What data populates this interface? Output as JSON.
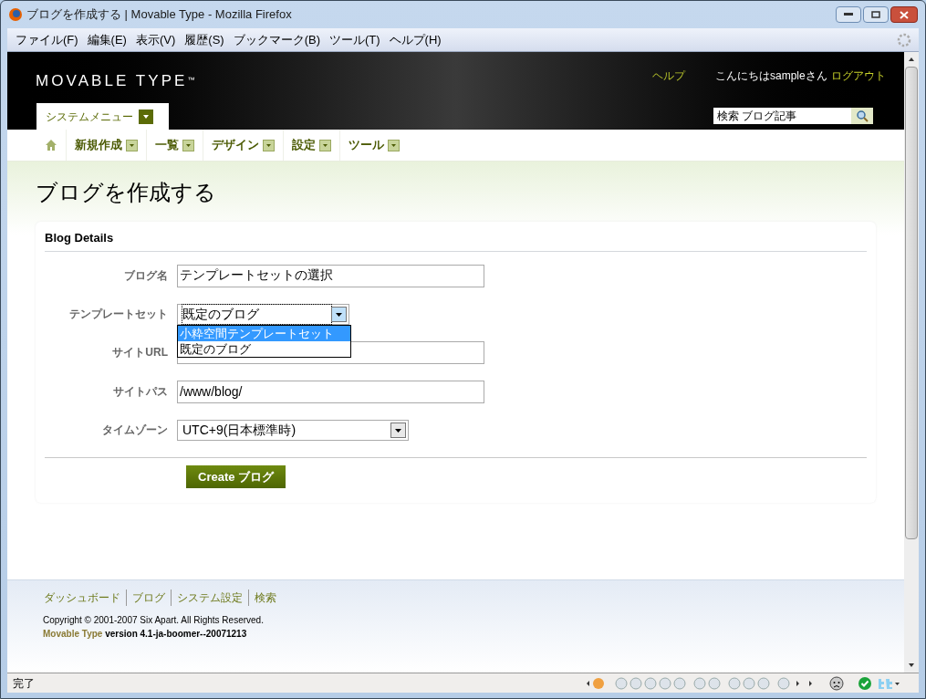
{
  "window": {
    "title": "ブログを作成する | Movable Type - Mozilla Firefox"
  },
  "menu_bar": [
    "ファイル(F)",
    "編集(E)",
    "表示(V)",
    "履歴(S)",
    "ブックマーク(B)",
    "ツール(T)",
    "ヘルプ(H)"
  ],
  "header": {
    "logo": "MOVABLE TYPE",
    "logo_mark": "™",
    "help": "ヘルプ",
    "greeting": "こんにちはsampleさん",
    "logout": "ログアウト",
    "system_menu": "システムメニュー",
    "search": {
      "value": "検索 ブログ記事"
    }
  },
  "nav": [
    "新規作成",
    "一覧",
    "デザイン",
    "設定",
    "ツール"
  ],
  "page_title": "ブログを作成する",
  "panel": {
    "title": "Blog Details",
    "fields": [
      {
        "kind": "text",
        "label": "ブログ名",
        "value": "テンプレートセットの選択"
      },
      {
        "kind": "select",
        "label": "テンプレートセット",
        "value": "既定のブログ",
        "expanded": true,
        "options": [
          {
            "label": "小粋空間テンプレートセット",
            "highlighted": true
          },
          {
            "label": "既定のブログ",
            "highlighted": false
          }
        ]
      },
      {
        "kind": "text",
        "label": "サイトURL"
      },
      {
        "kind": "text",
        "label": "サイトパス",
        "value": "/www/blog/"
      },
      {
        "kind": "select",
        "label": "タイムゾーン",
        "value": "UTC+9(日本標準時)",
        "expanded": false
      }
    ],
    "submit": "Create ブログ"
  },
  "footer": {
    "links": [
      "ダッシュボード",
      "ブログ",
      "システム設定",
      "検索"
    ],
    "copyright": "Copyright © 2001-2007 Six Apart. All Rights Reserved.",
    "product_link": "Movable Type",
    "version": "version 4.1-ja-boomer--20071213"
  },
  "status_bar": {
    "text": "完了"
  }
}
